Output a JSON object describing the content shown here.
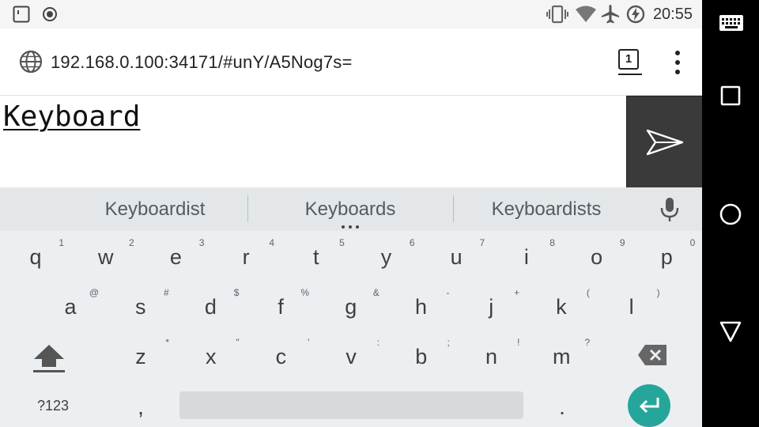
{
  "status_bar": {
    "time": "20:55",
    "left_icons": [
      "notification-icon",
      "record-icon"
    ],
    "right_icons": [
      "vibrate-icon",
      "wifi-icon",
      "airplane-mode-icon",
      "battery-charging-icon"
    ]
  },
  "browser": {
    "url": "192.168.0.100:34171/#unY/A5Nog7s=",
    "tab_count": "1",
    "menu_icon": "more-vert-icon",
    "site_icon": "globe-icon"
  },
  "page": {
    "input_text": "Keyboard",
    "send_icon": "send-icon"
  },
  "keyboard": {
    "suggestions": [
      "Keyboardist",
      "Keyboards",
      "Keyboardists"
    ],
    "row1": [
      {
        "key": "q",
        "hint": "1"
      },
      {
        "key": "w",
        "hint": "2"
      },
      {
        "key": "e",
        "hint": "3"
      },
      {
        "key": "r",
        "hint": "4"
      },
      {
        "key": "t",
        "hint": "5"
      },
      {
        "key": "y",
        "hint": "6"
      },
      {
        "key": "u",
        "hint": "7"
      },
      {
        "key": "i",
        "hint": "8"
      },
      {
        "key": "o",
        "hint": "9"
      },
      {
        "key": "p",
        "hint": "0"
      }
    ],
    "row2": [
      {
        "key": "a",
        "hint": "@"
      },
      {
        "key": "s",
        "hint": "#"
      },
      {
        "key": "d",
        "hint": "$"
      },
      {
        "key": "f",
        "hint": "%"
      },
      {
        "key": "g",
        "hint": "&"
      },
      {
        "key": "h",
        "hint": "-"
      },
      {
        "key": "j",
        "hint": "+"
      },
      {
        "key": "k",
        "hint": "("
      },
      {
        "key": "l",
        "hint": ")"
      }
    ],
    "row3": [
      {
        "key": "z",
        "hint": "*"
      },
      {
        "key": "x",
        "hint": "\""
      },
      {
        "key": "c",
        "hint": "'"
      },
      {
        "key": "v",
        "hint": ":"
      },
      {
        "key": "b",
        "hint": ";"
      },
      {
        "key": "n",
        "hint": "!"
      },
      {
        "key": "m",
        "hint": "?"
      }
    ],
    "symbols_key": "?123",
    "comma_key": ",",
    "period_key": ".",
    "accent_color": "#26a69a"
  },
  "nav_bar": {
    "buttons": [
      "keyboard-switch-icon",
      "recents-icon",
      "home-icon",
      "back-icon"
    ]
  }
}
